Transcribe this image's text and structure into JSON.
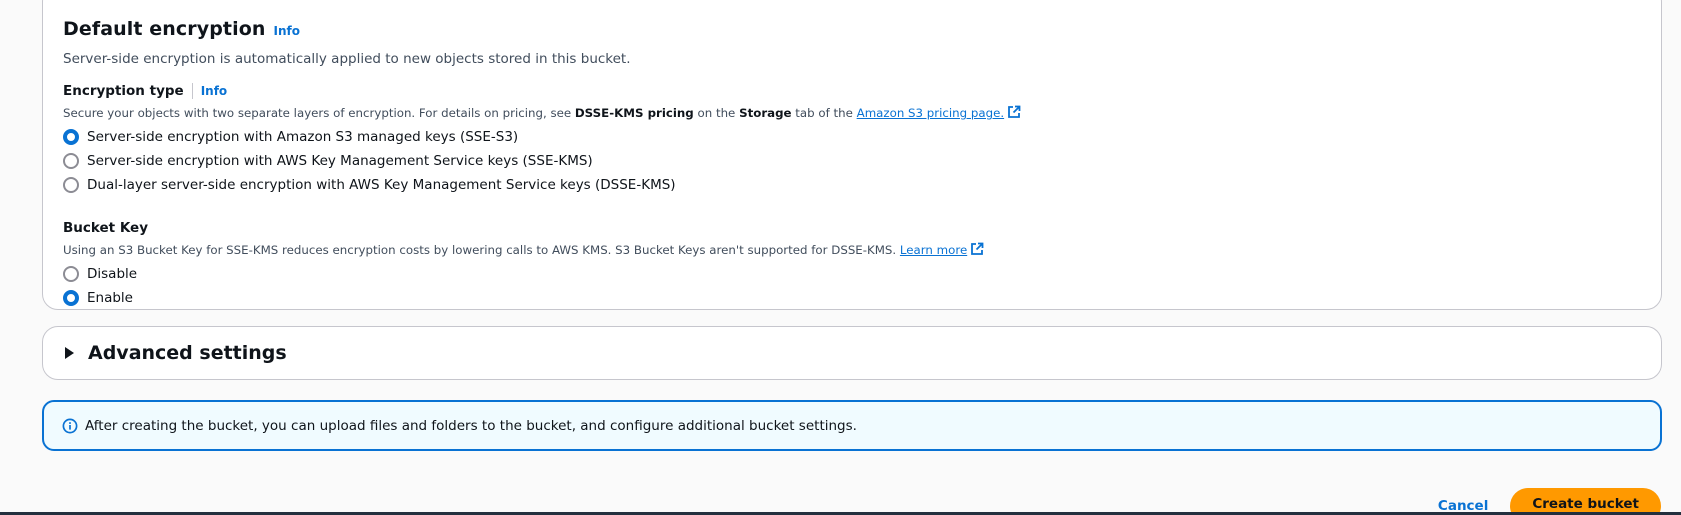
{
  "encryption": {
    "title": "Default encryption",
    "info": "Info",
    "description": "Server-side encryption is automatically applied to new objects stored in this bucket.",
    "type": {
      "label": "Encryption type",
      "info": "Info",
      "desc_before": "Secure your objects with two separate layers of encryption. For details on pricing, see ",
      "desc_bold1": "DSSE-KMS pricing",
      "desc_mid": " on the ",
      "desc_bold2": "Storage",
      "desc_after": " tab of the ",
      "desc_link": "Amazon S3 pricing page.",
      "options": [
        {
          "label": "Server-side encryption with Amazon S3 managed keys (SSE-S3)",
          "checked": true
        },
        {
          "label": "Server-side encryption with AWS Key Management Service keys (SSE-KMS)",
          "checked": false
        },
        {
          "label": "Dual-layer server-side encryption with AWS Key Management Service keys (DSSE-KMS)",
          "checked": false
        }
      ]
    },
    "bucket_key": {
      "label": "Bucket Key",
      "desc": "Using an S3 Bucket Key for SSE-KMS reduces encryption costs by lowering calls to AWS KMS. S3 Bucket Keys aren't supported for DSSE-KMS. ",
      "link": "Learn more",
      "options": [
        {
          "label": "Disable",
          "checked": false
        },
        {
          "label": "Enable",
          "checked": true
        }
      ]
    }
  },
  "advanced": {
    "title": "Advanced settings"
  },
  "alert": {
    "text": "After creating the bucket, you can upload files and folders to the bucket, and configure additional bucket settings."
  },
  "footer": {
    "cancel": "Cancel",
    "create": "Create bucket"
  },
  "colors": {
    "accent": "#0972d3",
    "primary_button": "#ff9900",
    "alert_bg": "#f0fbff"
  },
  "icons": {
    "external": "external-link-icon",
    "info": "info-circle-icon",
    "caret": "caret-right-icon"
  }
}
